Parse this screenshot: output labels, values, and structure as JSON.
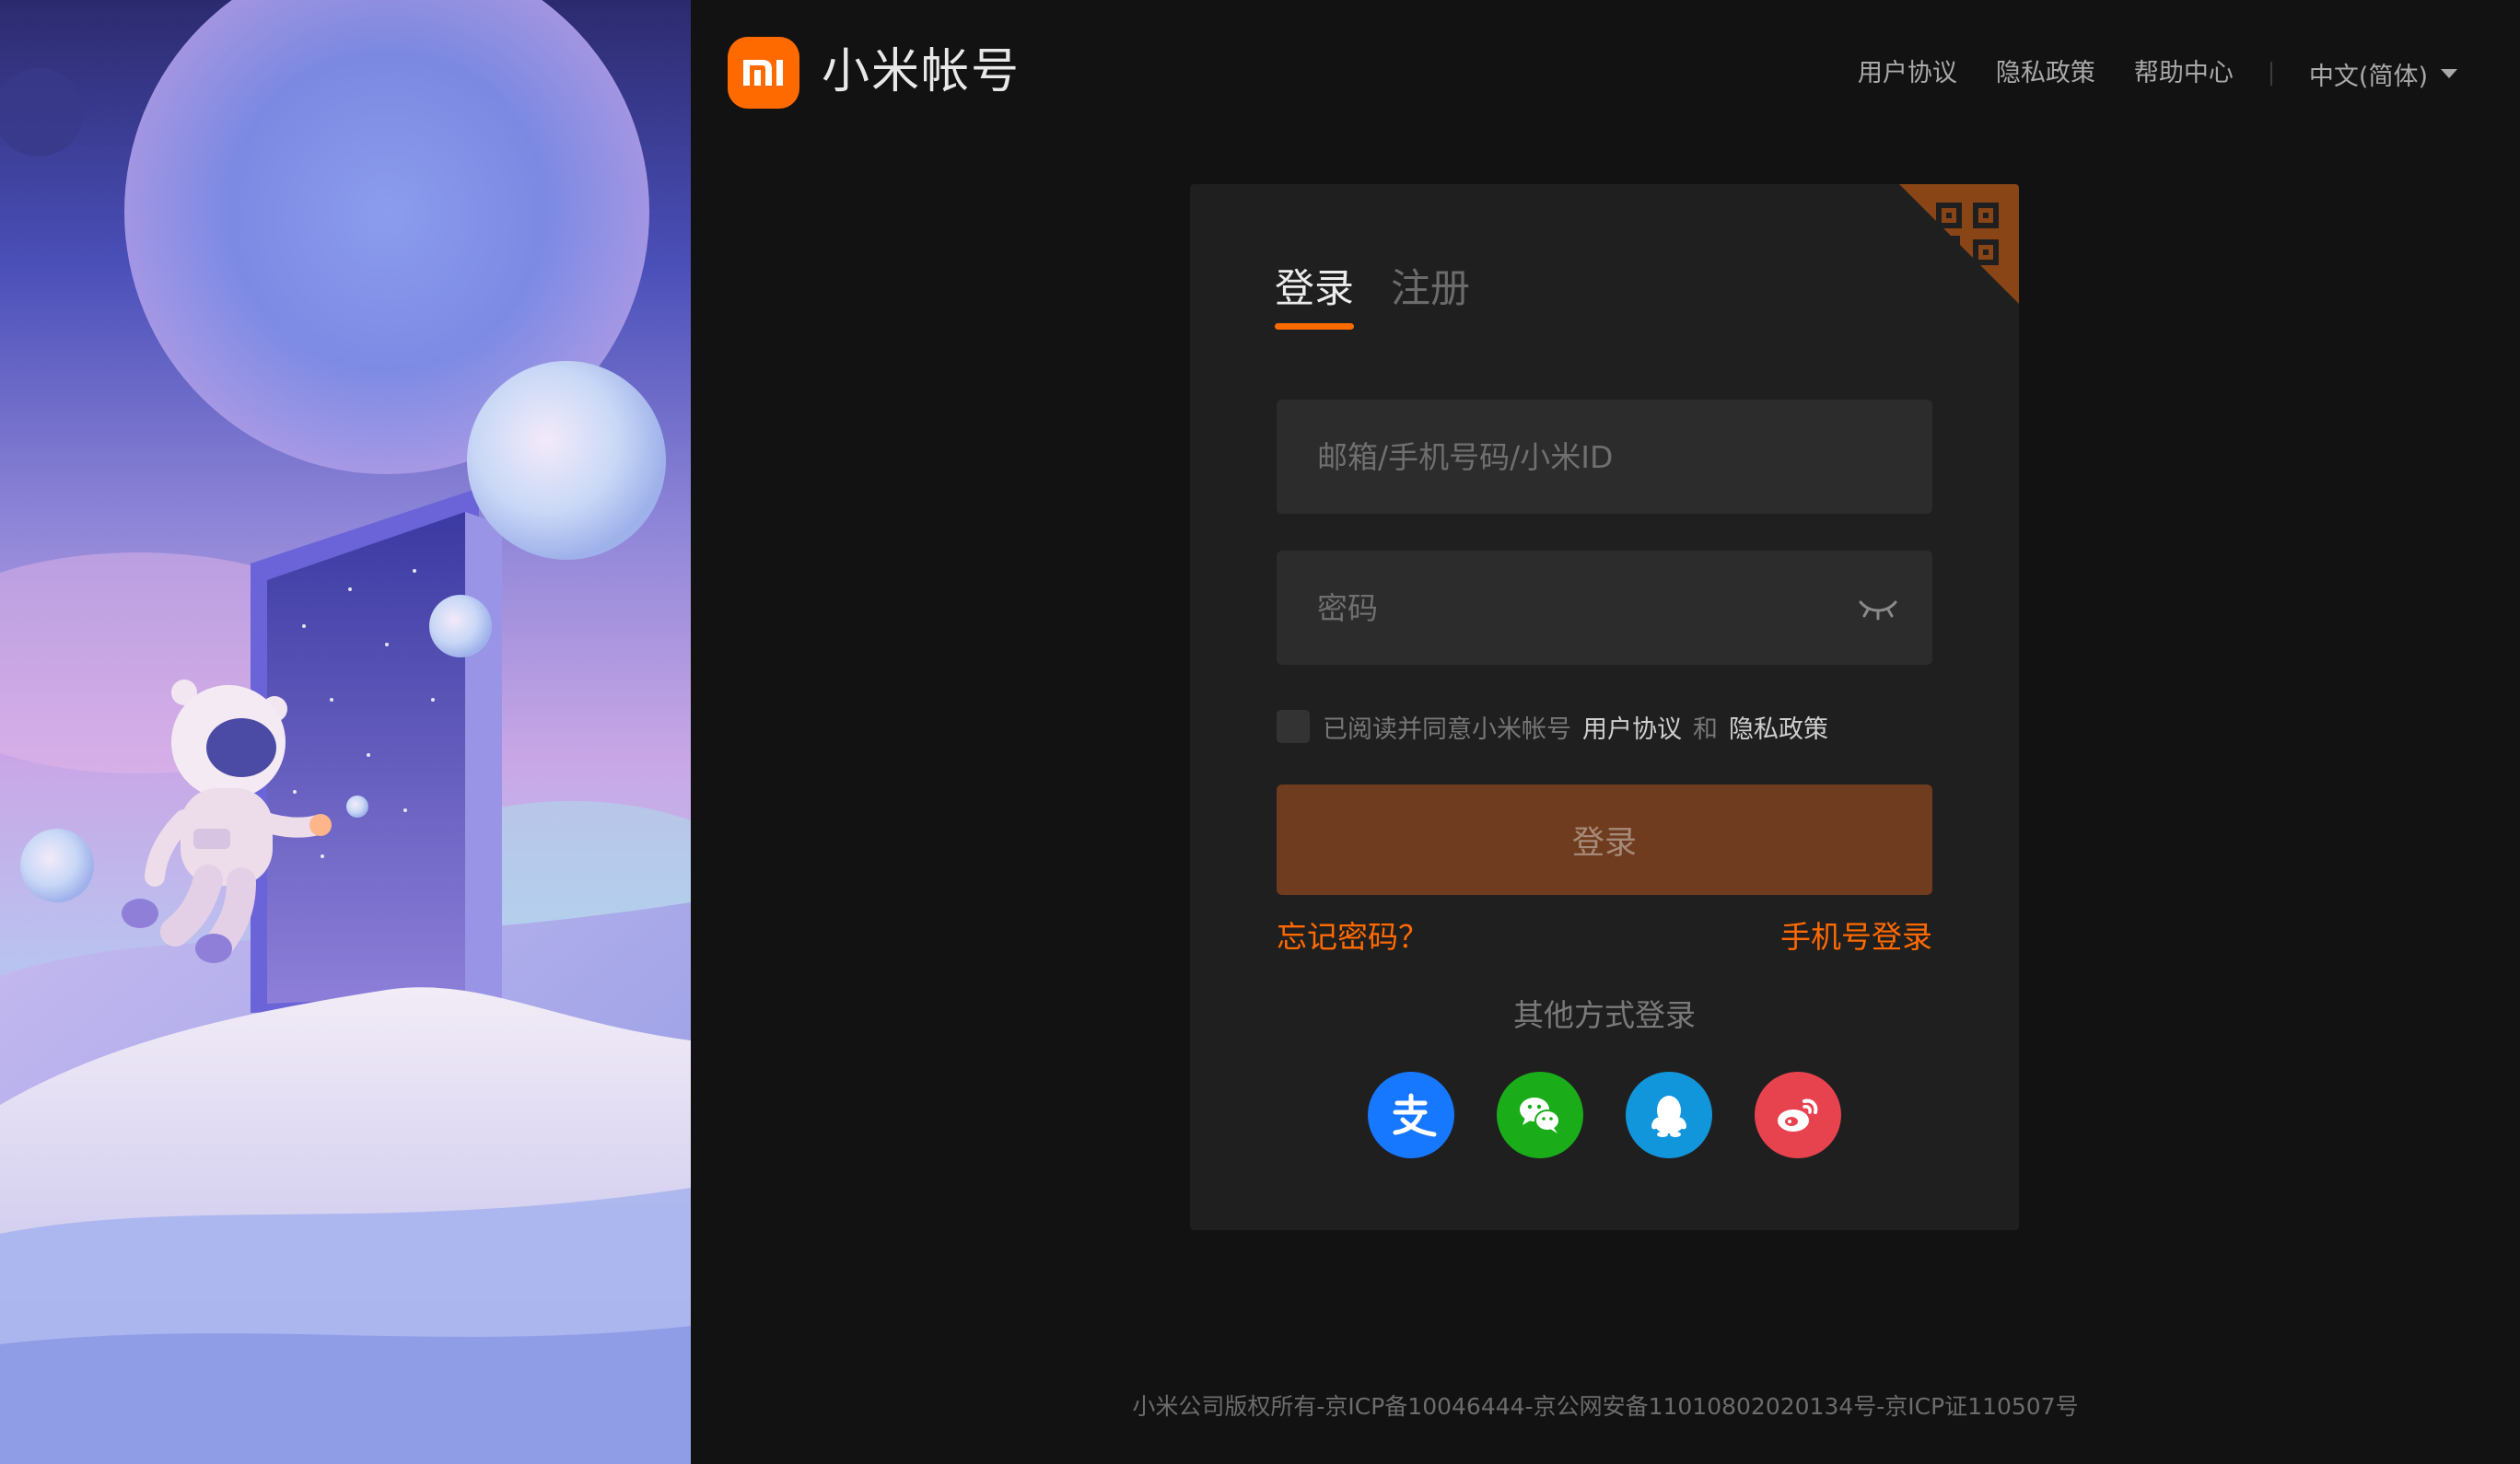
{
  "colors": {
    "accent": "#ff6a00",
    "page_bg": "#121212",
    "card_bg": "#1f1f1f",
    "login_button_bg": "#703c1f"
  },
  "header": {
    "logo_icon": "mi-logo-icon",
    "brand_name": "小米帐号",
    "nav_links": [
      "用户协议",
      "隐私政策",
      "帮助中心"
    ],
    "language": "中文(简体)"
  },
  "card": {
    "qr_icon": "qr-code-icon",
    "tabs": [
      {
        "label": "登录",
        "active": true
      },
      {
        "label": "注册",
        "active": false
      }
    ],
    "account_placeholder": "邮箱/手机号码/小米ID",
    "password_placeholder": "密码",
    "password_toggle_icon": "eye-closed-icon",
    "agreement": {
      "prefix": "已阅读并同意小米帐号",
      "user_agreement": "用户协议",
      "and": "和",
      "privacy_policy": "隐私政策"
    },
    "login_button": "登录",
    "forgot_password": "忘记密码？",
    "phone_login": "手机号登录",
    "other_methods_title": "其他方式登录",
    "social_logins": [
      {
        "name": "alipay",
        "icon": "alipay-icon"
      },
      {
        "name": "wechat",
        "icon": "wechat-icon"
      },
      {
        "name": "qq",
        "icon": "qq-icon"
      },
      {
        "name": "weibo",
        "icon": "weibo-icon"
      }
    ]
  },
  "footer": {
    "text": "小米公司版权所有-京ICP备10046444-京公网安备11010802020134号-京ICP证110507号"
  }
}
